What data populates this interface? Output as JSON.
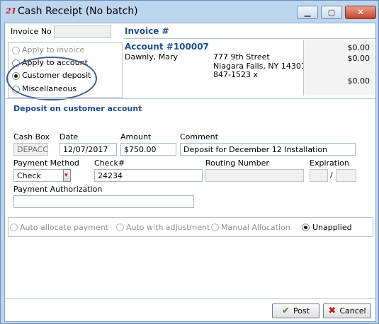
{
  "window": {
    "app_icon_glyph": "21",
    "title": "Cash Receipt (No batch)",
    "controls": {
      "minimize": "▁",
      "maximize": "▢",
      "close": "✕"
    }
  },
  "invoice_no": {
    "label": "Invoice No",
    "value": ""
  },
  "apply_options": [
    {
      "label": "Apply to invoice",
      "selected": false,
      "enabled": false
    },
    {
      "label": "Apply to account",
      "selected": false,
      "enabled": true
    },
    {
      "label": "Customer deposit",
      "selected": true,
      "enabled": true
    },
    {
      "label": "Miscellaneous",
      "selected": false,
      "enabled": true
    }
  ],
  "invoice_panel": {
    "header": "Invoice #",
    "account": "Account #100007",
    "customer_name": "Dawnly, Mary",
    "address_line1": "777 9th Street",
    "address_line2": "Niagara Falls, NY  14301",
    "phone": "847-1523 x",
    "amounts": [
      "$0.00",
      "$0.00",
      "$0.00"
    ]
  },
  "deposit": {
    "section_title": "Deposit on customer account",
    "cash_box_label": "Cash Box",
    "cash_box_value": "DEPACCT",
    "date_label": "Date",
    "date_value": "12/07/2017",
    "amount_label": "Amount",
    "amount_value": "$750.00",
    "comment_label": "Comment",
    "comment_value": "Deposit for December 12 Installation",
    "payment_method_label": "Payment Method",
    "payment_method_value": "Check",
    "check_label": "Check#",
    "check_value": "24234",
    "routing_label": "Routing Number",
    "routing_value": "",
    "expiration_label": "Expiration",
    "expiration_separator": "/",
    "payment_auth_label": "Payment Authorization",
    "payment_auth_value": ""
  },
  "allocation": [
    {
      "label": "Auto allocate payment",
      "selected": false,
      "enabled": false
    },
    {
      "label": "Auto with adjustment",
      "selected": false,
      "enabled": false
    },
    {
      "label": "Manual Allocation",
      "selected": false,
      "enabled": false
    },
    {
      "label": "Unapplied",
      "selected": true,
      "enabled": true
    }
  ],
  "buttons": {
    "post_icon": "✔",
    "post_label": "Post",
    "cancel_icon": "✖",
    "cancel_label": "Cancel"
  },
  "icons": {
    "app": "app-logo-icon",
    "post": "checkmark-icon",
    "cancel": "x-icon",
    "dropdown": "chevron-down-icon"
  }
}
